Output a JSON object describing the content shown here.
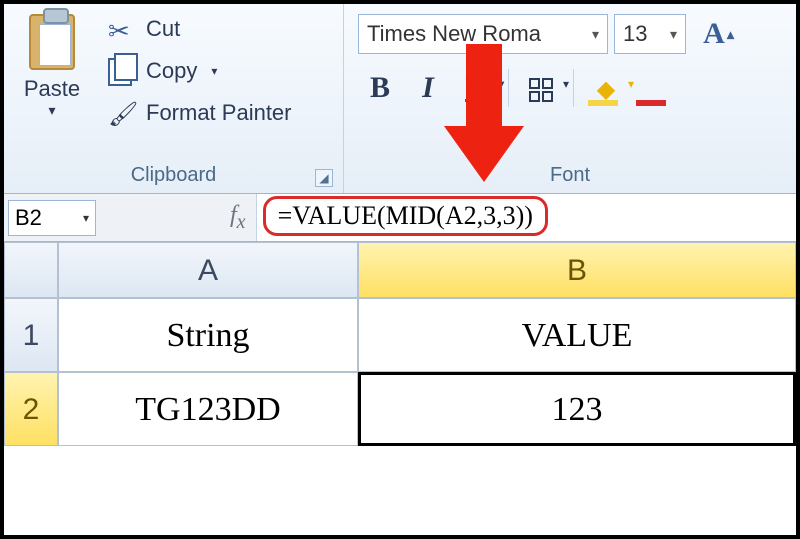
{
  "ribbon": {
    "clipboard": {
      "label": "Clipboard",
      "paste": "Paste",
      "cut": "Cut",
      "copy": "Copy",
      "format_painter": "Format Painter"
    },
    "font": {
      "label": "Font",
      "font_name": "Times New Roma",
      "font_size": "13",
      "bold": "B",
      "italic": "I",
      "underline": "U"
    }
  },
  "name_box": "B2",
  "formula": "=VALUE(MID(A2,3,3))",
  "columns": {
    "A": "A",
    "B": "B"
  },
  "rows": {
    "r1": "1",
    "r2": "2"
  },
  "cells": {
    "A1": "String",
    "B1": "VALUE",
    "A2": "TG123DD",
    "B2": "123"
  }
}
